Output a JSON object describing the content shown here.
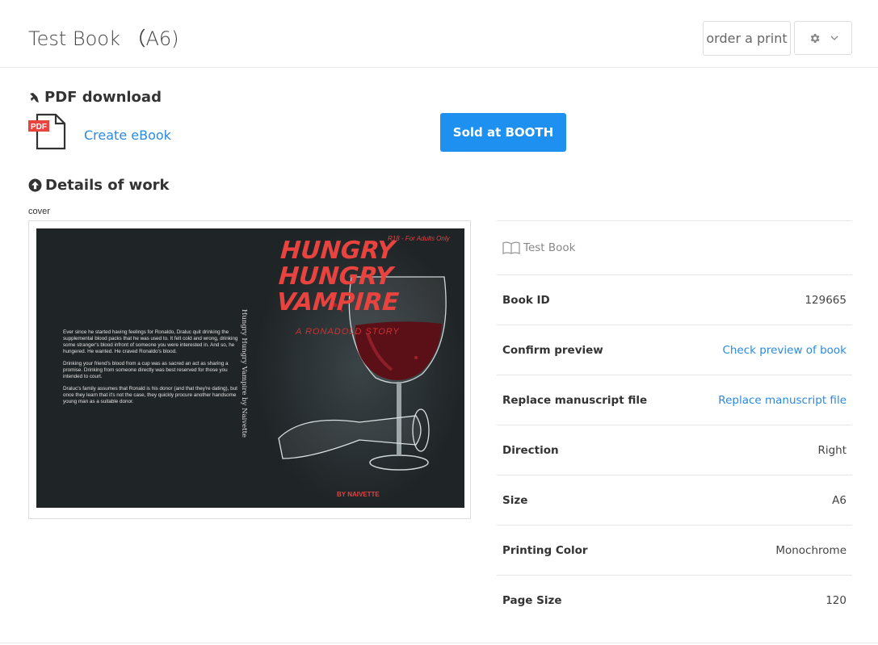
{
  "header": {
    "title": "Test Book （A6)",
    "order_label": "order a print",
    "settings_icon": "gear-icon",
    "dropdown_icon": "chevron-down-icon"
  },
  "pdf_section": {
    "title": "PDF download",
    "icon": "rocket-icon",
    "pdf_badge": "PDF",
    "create_ebook": "Create eBook",
    "sold_button": "Sold at BOOTH"
  },
  "details_section": {
    "title": "Details of work",
    "icon": "arrow-up-circle-icon",
    "cover_label": "cover"
  },
  "cover": {
    "title_lines": [
      "HUNGRY",
      "HUNGRY",
      "VAMPIRE"
    ],
    "subtitle": "A RONADOLD STORY",
    "rating": "R18 - For Adults Only",
    "spine": "Hungry Hungry Vampire by Naivette",
    "author": "BY NAIVETTE",
    "back_paragraphs": [
      "Ever since he started having feelings for Ronaldo, Draluc quit drinking the supplemental blood packs that he was used to. It felt cold and wrong, drinking some stranger's blood infront of someone you were interested in. And so, he hungered. He wanted. He craved Ronaldo's blood.",
      "Drinking your friend's blood from a cup was as sacred an act as sharing a promise. Drinking from someone directly was best reserved for those you intended to court.",
      "Draluc's family assumes that Ronald is his donor (and that they're dating), but once they learn that it's not the case, they quickly procure another handsome young man as a suitable donor."
    ]
  },
  "info": {
    "book_name": "Test Book",
    "book_icon": "open-book-icon",
    "rows": [
      {
        "key": "Book ID",
        "value": "129665"
      },
      {
        "key": "Confirm preview",
        "value": "Check preview of book"
      },
      {
        "key": "Replace manuscript file",
        "value": "Replace manuscript file"
      },
      {
        "key": "Direction",
        "value": "Right"
      },
      {
        "key": "Size",
        "value": "A6"
      },
      {
        "key": "Printing Color",
        "value": "Monochrome"
      },
      {
        "key": "Page Size",
        "value": "120"
      }
    ]
  },
  "colors": {
    "accent": "#1e90f0",
    "link": "#2a8ae0",
    "cover_bg": "#1f2426",
    "cover_title": "#e8433f"
  }
}
